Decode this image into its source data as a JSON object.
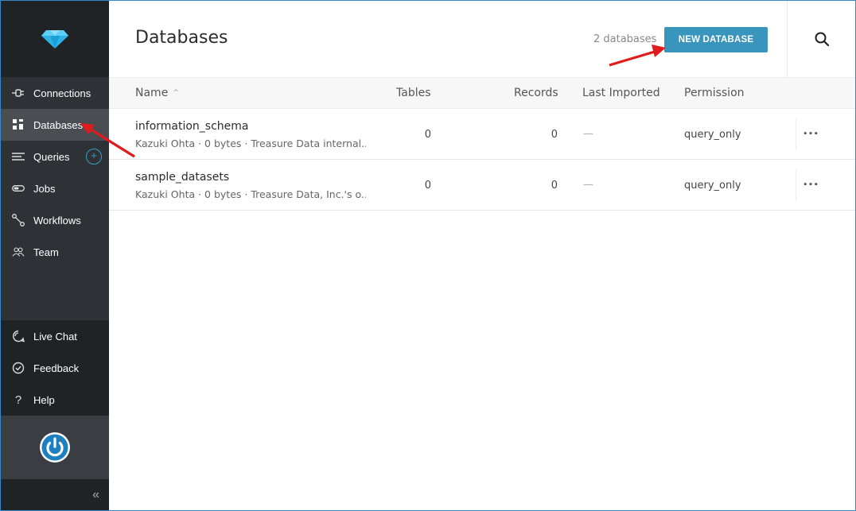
{
  "sidebar": {
    "logo": "treasure-data-diamond-icon",
    "items": [
      {
        "label": "Connections",
        "icon": "plug-icon"
      },
      {
        "label": "Databases",
        "icon": "grid-icon",
        "active": true
      },
      {
        "label": "Queries",
        "icon": "list-icon",
        "add_label": "+"
      },
      {
        "label": "Jobs",
        "icon": "toggle-icon"
      },
      {
        "label": "Workflows",
        "icon": "workflow-icon"
      },
      {
        "label": "Team",
        "icon": "team-icon"
      }
    ],
    "bottom_items": [
      {
        "label": "Live Chat",
        "icon": "chat-icon"
      },
      {
        "label": "Feedback",
        "icon": "feedback-icon"
      },
      {
        "label": "Help",
        "icon": "help-icon"
      }
    ],
    "collapse_label": "«"
  },
  "header": {
    "title": "Databases",
    "count": "2 databases",
    "new_button": "NEW DATABASE"
  },
  "table": {
    "columns": {
      "name": "Name",
      "tables": "Tables",
      "records": "Records",
      "imported": "Last Imported",
      "permission": "Permission"
    },
    "rows": [
      {
        "name": "information_schema",
        "meta": "Kazuki Ohta · 0 bytes · Treasure Data internal...",
        "tables": "0",
        "records": "0",
        "imported": "—",
        "permission": "query_only",
        "more": "•••"
      },
      {
        "name": "sample_datasets",
        "meta": "Kazuki Ohta · 0 bytes · Treasure Data, Inc.'s o...",
        "tables": "0",
        "records": "0",
        "imported": "—",
        "permission": "query_only",
        "more": "•••"
      }
    ]
  },
  "colors": {
    "accent": "#3a95bd",
    "sidebar_bg": "#2e3236",
    "annotation_arrow": "#e01b1b"
  }
}
